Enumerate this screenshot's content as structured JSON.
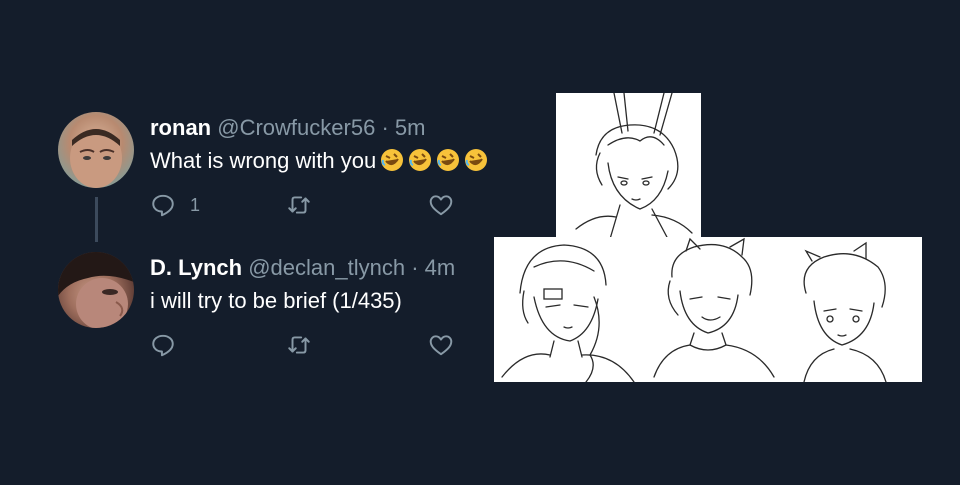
{
  "tweets": [
    {
      "name": "ronan",
      "handle": "@Crowfucker56",
      "separator": "·",
      "time": "5m",
      "text": "What is  wrong with you",
      "emoji": [
        "rolling-on-floor-laughing",
        "rolling-on-floor-laughing",
        "rolling-on-floor-laughing",
        "rolling-on-floor-laughing"
      ],
      "reply_count": "1"
    },
    {
      "name": "D. Lynch",
      "handle": "@declan_tlynch",
      "separator": "·",
      "time": "4m",
      "text": "i will try to be brief (1/435)"
    }
  ],
  "icons": {
    "reply": "speech-bubble-icon",
    "retweet": "retweet-arrows-icon",
    "like": "heart-icon"
  },
  "colors": {
    "background": "#141d2b",
    "secondary_text": "#8899a6",
    "primary_text": "#ffffff",
    "thread_line": "#3c4a5c"
  }
}
